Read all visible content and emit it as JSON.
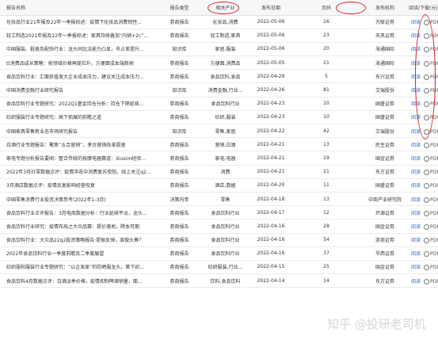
{
  "headers": {
    "title": "报告名称",
    "type": "报告类型",
    "industry": "相关产业",
    "date": "发布日期",
    "pages": "页码",
    "org": "发布机构",
    "action": "阅读/下载(元)"
  },
  "action": {
    "read_label": "阅读",
    "download_label": "PDF下载(免费)"
  },
  "rows": [
    {
      "title": "化妆品行业21年报及22年一季报综述：疫情下化妆品消费韧性...",
      "type": "券商报告",
      "industry": "化妆品,消费",
      "date": "2022-05-06",
      "pages": "16",
      "org": "万联证券"
    },
    {
      "title": "轻工制造2021年报及22年一季报综述：家具持续叠加“内销+2c”...",
      "type": "券商报告",
      "industry": "轻工制造,家具",
      "date": "2022-05-06",
      "pages": "23",
      "org": "天风证券"
    },
    {
      "title": "中国服装、鞋类及配饰行业：龙头同比法能力凸显，市占差提升...",
      "type": "知识库",
      "industry": "家居,服装",
      "date": "2022-05-06",
      "pages": "20",
      "org": "海通国际"
    },
    {
      "title": "tt消费品成长策略：按领域价格再度拉升，方便面成本端新闻",
      "type": "券商报告",
      "industry": "方便面,消费品",
      "date": "2022-05-05",
      "pages": "21",
      "org": "海通国际"
    },
    {
      "title": "食品饮料行业：汇面获值发大企业成本压力，建议关注成本压力...",
      "type": "券商报告",
      "industry": "食品饮料,食品",
      "date": "2022-04-29",
      "pages": "5",
      "org": "东兴证券"
    },
    {
      "title": "中国消费金融行业研究报告",
      "type": "知识库",
      "industry": "消费金融,行业...",
      "date": "2022-04-26",
      "pages": "81",
      "org": "艾瑞股份"
    },
    {
      "title": "食品饮料行业专题研究：2022Q1基金持仓分析：持仓下降延续...",
      "type": "券商报告",
      "industry": "食品饮料行业",
      "date": "2022-04-23",
      "pages": "10",
      "org": "国盛证券"
    },
    {
      "title": "纺织服装行业专题研究：高下拓展的前瞻之道",
      "type": "券商报告",
      "industry": "纺织,服装",
      "date": "2022-04-23",
      "pages": "10",
      "org": "国盛证券"
    },
    {
      "title": "中国家具零售新业态市场研究报告",
      "type": "知识库",
      "industry": "零售,家居",
      "date": "2022-04-22",
      "pages": "42",
      "org": "艾瑞股份"
    },
    {
      "title": "白酒行业专题报告：聚焦“五合营销”，茅台营销改革提速",
      "type": "券商报告",
      "industry": "营销,白酒",
      "date": "2022-04-21",
      "pages": "13",
      "org": "民生证券"
    },
    {
      "title": "家电专题分析报告要闻：整合传统的按摩电器赛道：从osim经验...",
      "type": "券商报告",
      "industry": "家电,电器",
      "date": "2022-04-21",
      "pages": "19",
      "org": "国金证券"
    },
    {
      "title": "2022年3月社零数据点评：疫情冲击中消费复苏受阻，线上关注q2...",
      "type": "券商报告",
      "industry": "消费",
      "date": "2022-04-21",
      "pages": "21",
      "org": "东方证券"
    },
    {
      "title": "3月酒店数据点评：疫情反复影响经营恢复",
      "type": "券商报告",
      "industry": "酒店,数据",
      "date": "2022-04-20",
      "pages": "11",
      "org": "国盛证券"
    },
    {
      "title": "中国零售消费行业投资决策参考(2022年1-3月)",
      "type": "决策内参",
      "industry": "零售",
      "date": "2022-04-18",
      "pages": "13",
      "org": "中商产业研究院"
    },
    {
      "title": "食品饮料行业点评报告：3月电商数据分析：行业延续平淡，龙头...",
      "type": "券商报告",
      "industry": "食品饮料行业",
      "date": "2022-04-17",
      "pages": "12",
      "org": "开源证券"
    },
    {
      "title": "食品饮料行业研究：疫情布局之大众品赛：提价落地，降本可期",
      "type": "券商报告",
      "industry": "食品饮料行业",
      "date": "2022-04-16",
      "pages": "28",
      "org": "国金证券"
    },
    {
      "title": "食品饮料行业：大众品22q2投资策略报告·提振反弹，谁做头筹？",
      "type": "券商报告",
      "industry": "食品饮料行业",
      "date": "2022-04-16",
      "pages": "54",
      "org": "浙商证券"
    },
    {
      "title": "2022年食品饮料行业一季度前瞻及二季度展望",
      "type": "券商报告",
      "industry": "食品饮料行业",
      "date": "2022-04-16",
      "pages": "37",
      "org": "华西证券"
    },
    {
      "title": "纺织服和服装行业专题研究：“以企发家”的防晒服龙头，第下初...",
      "type": "券商报告",
      "industry": "纺织服装,行业...",
      "date": "2022-04-15",
      "pages": "25",
      "org": "国金证券"
    },
    {
      "title": "食品饮料4月数据点评：白酒淡季价格，疫情抑制啤酒销量，面...",
      "type": "券商报告",
      "industry": "饮料,食品饮料",
      "date": "2022-04-14",
      "pages": "14",
      "org": "东方证券"
    }
  ],
  "watermark": "知乎 @投研老司机"
}
